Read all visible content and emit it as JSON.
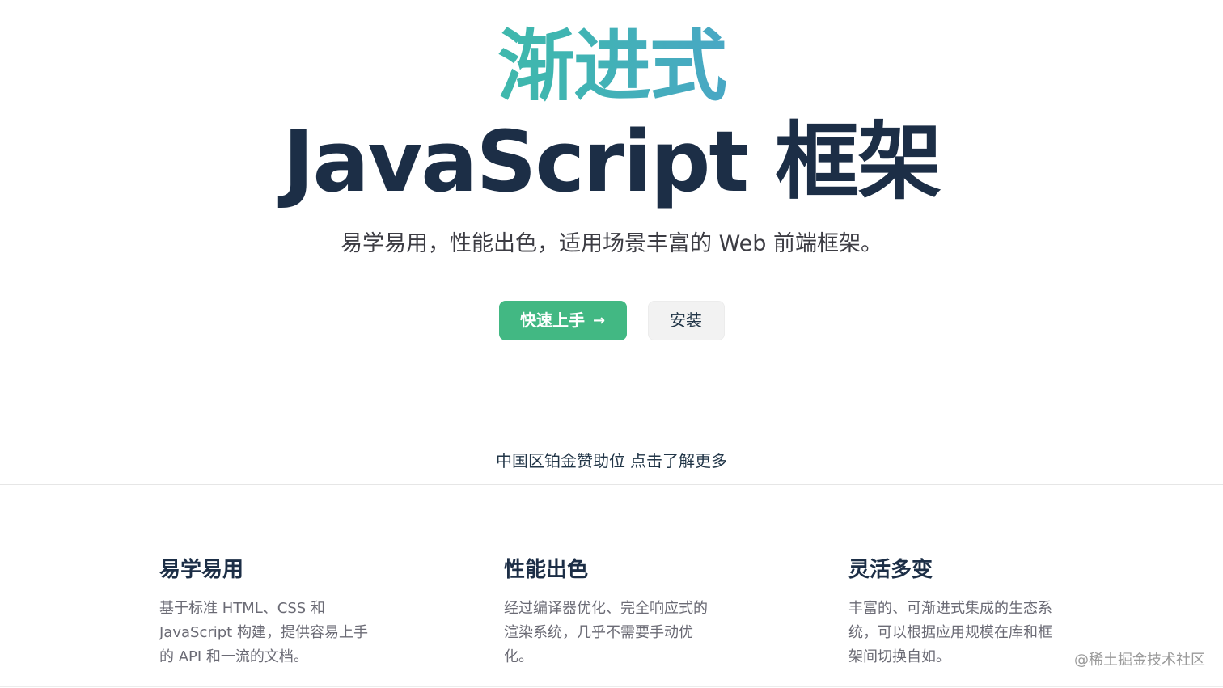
{
  "hero": {
    "tagline": "渐进式",
    "headline": "JavaScript 框架",
    "subtitle": "易学易用，性能出色，适用场景丰富的 Web 前端框架。",
    "primary_button": "快速上手",
    "primary_button_arrow": "→",
    "secondary_button": "安装"
  },
  "sponsor": {
    "text": "中国区铂金赞助位",
    "cta": "点击了解更多"
  },
  "features": [
    {
      "title": "易学易用",
      "lines": [
        "基于标准 HTML、CSS 和",
        "JavaScript 构建，提供容易上手",
        "的 API 和一流的文档。"
      ]
    },
    {
      "title": "性能出色",
      "lines": [
        "经过编译器优化、完全响应式的",
        "渲染系统，几乎不需要手动优",
        "化。"
      ]
    },
    {
      "title": "灵活多变",
      "lines": [
        "丰富的、可渐进式集成的生态系",
        "统，可以根据应用规模在库和框",
        "架间切换自如。"
      ]
    }
  ],
  "watermark": "@稀土掘金技术社区",
  "colors": {
    "brand_green": "#42b883",
    "gradient_end": "#647eff",
    "heading_dark": "#1c2e46"
  }
}
